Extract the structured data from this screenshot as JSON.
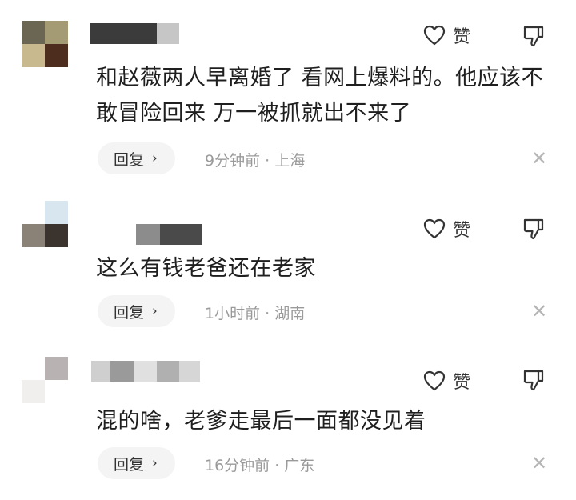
{
  "comments": [
    {
      "text": "和赵薇两人早离婚了 看网上爆料的。他应该不敢冒险回来 万一被抓就出不来了",
      "like_label": "赞",
      "reply_label": "回复",
      "meta": "9分钟前 · 上海"
    },
    {
      "text": "这么有钱老爸还在老家",
      "like_label": "赞",
      "reply_label": "回复",
      "meta": "1小时前 · 湖南"
    },
    {
      "text": "混的啥，老爹走最后一面都没见着",
      "like_label": "赞",
      "reply_label": "回复",
      "meta": "16分钟前 · 广东"
    }
  ],
  "icons": {
    "like": "heart-icon",
    "dislike": "thumbs-down-icon",
    "reply_chevron": "chevron-right-icon",
    "close": "close-icon"
  },
  "glyphs": {
    "chevron": "›",
    "close": "✕"
  }
}
